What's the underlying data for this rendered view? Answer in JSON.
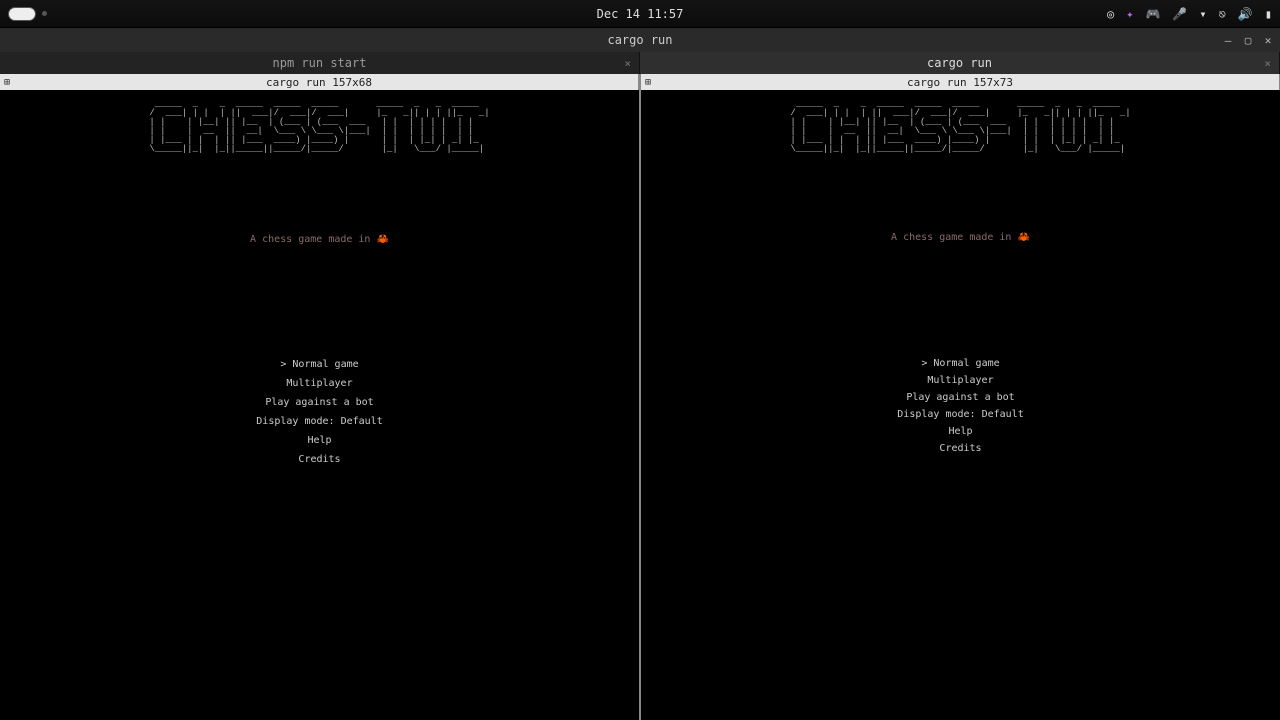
{
  "sysbar": {
    "datetime": "Dec 14  11:57"
  },
  "window": {
    "title": "cargo run"
  },
  "tabs": [
    {
      "label": "npm run start",
      "active": false
    },
    {
      "label": "cargo run",
      "active": true
    }
  ],
  "panes": [
    {
      "title": "cargo run 157x68"
    },
    {
      "title": "cargo run 157x73"
    }
  ],
  "app": {
    "logo": " _____  _    _  _____  _____  _____       _____  _   _  _____ \n/  ___| | |  | ||  ___|/  ___|/  ___|     |_   _|| | | ||_   _|\n| |    | |__| || |__  | (___ | (___  ___   | |  | | | |  | |  \n| |    |  __  ||  __|  \\___ \\ \\___ \\|___|  | |  | | | |  | |  \n| |___ | |  | || |___  ____) |____) |      | |  | |_| | _| |_ \n\\_____||_|  |_||_____||_____/|_____/       |_|   \\___/ |_____|",
    "tagline": "A chess game made in 🦀"
  },
  "menu": {
    "items": [
      "Normal game",
      "Multiplayer",
      "Play against a bot",
      "Display mode: Default",
      "Help",
      "Credits"
    ],
    "selected_index": 0
  }
}
